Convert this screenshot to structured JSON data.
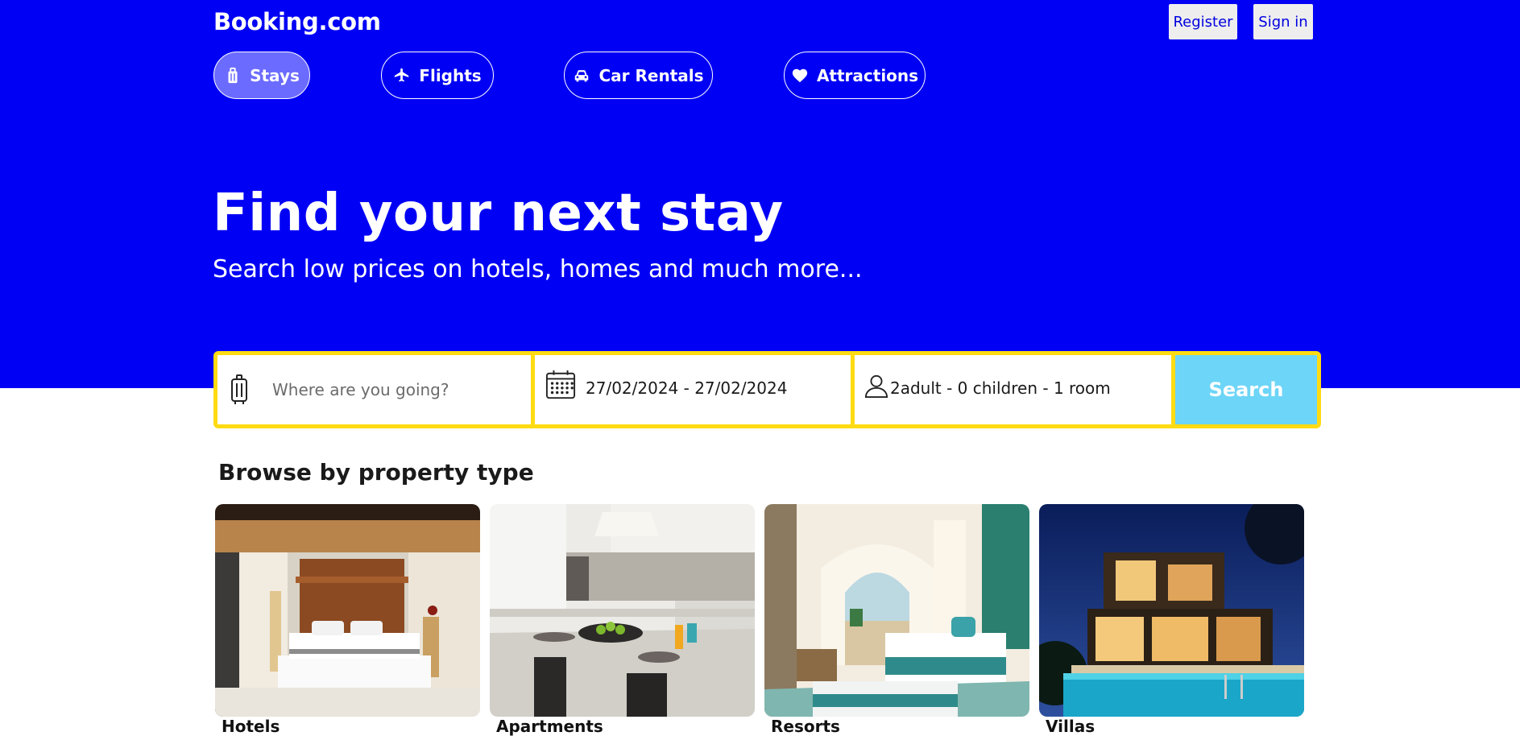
{
  "header": {
    "logo": "Booking.com",
    "register_label": "Register",
    "signin_label": "Sign in"
  },
  "nav": {
    "items": [
      {
        "label": "Stays",
        "icon": "suitcase-icon",
        "active": true
      },
      {
        "label": "Flights",
        "icon": "plane-icon",
        "active": false
      },
      {
        "label": "Car Rentals",
        "icon": "car-icon",
        "active": false
      },
      {
        "label": "Attractions",
        "icon": "heart-icon",
        "active": false
      }
    ]
  },
  "hero": {
    "title": "Find your next stay",
    "subtitle": "Search low prices on hotels, homes and much more..."
  },
  "search": {
    "destination_placeholder": "Where are you going?",
    "destination_value": "",
    "dates": "27/02/2024 - 27/02/2024",
    "guests": "2adult - 0 children - 1 room",
    "button_label": "Search"
  },
  "browse": {
    "title": "Browse by property type",
    "items": [
      {
        "label": "Hotels"
      },
      {
        "label": "Apartments"
      },
      {
        "label": "Resorts"
      },
      {
        "label": "Villas"
      }
    ]
  },
  "colors": {
    "brand_blue": "#0000f5",
    "search_border": "#fedb12",
    "search_button": "#6dd5f7",
    "active_pill": "#6b6bff"
  }
}
